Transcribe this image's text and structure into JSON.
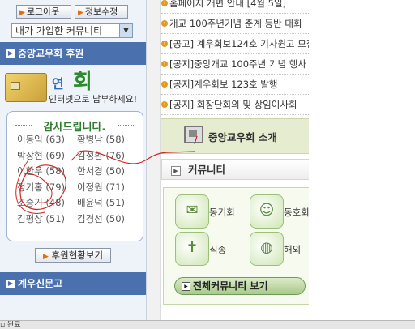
{
  "left": {
    "logout_label": "로그아웃",
    "edit_info_label": "정보수정",
    "community_select": "내가 가입한 커뮤니티",
    "support_heading": "중앙교우회 후원",
    "banner": {
      "big1": "연",
      "big2": "회",
      "sub": "인터넷으로 납부하세요!"
    },
    "thanks_title": "감사드립니다.",
    "donors": [
      [
        "이동익 (63)",
        "황병남 (58)"
      ],
      [
        "박상현 (69)",
        "김성환 (76)"
      ],
      [
        "이한우 (58)",
        "한서경 (50)"
      ],
      [
        "정기홍 (79)",
        "이정원 (71)"
      ],
      [
        "조승기 (48)",
        "배윤덕 (51)"
      ],
      [
        "김평상 (51)",
        "김경선 (50)"
      ]
    ],
    "view_status_label": "후원현황보기",
    "news_heading": "계우신문고"
  },
  "right": {
    "notices": [
      "홈페이지 개편 안내 [4월 5일]",
      "개교 100주년기념 춘계 등반 대회",
      "[공고] 계우회보124호 기사원고 모집",
      "[공지]중앙개교 100주년 기념 행사",
      "[공지]계우회보 123호 발행",
      "[공지] 회장단회의 및 상임이사회"
    ],
    "intro_label": "중앙교우회 소개",
    "community_heading": "커뮤니티",
    "community_items": [
      {
        "label": "동기회",
        "icon": "dongihoe-icon"
      },
      {
        "label": "동호회",
        "icon": "club-icon"
      },
      {
        "label": "직종",
        "icon": "job-icon"
      },
      {
        "label": "해외",
        "icon": "globe-icon"
      }
    ],
    "all_community_label": "전체커뮤니티 보기"
  },
  "status_bar": {
    "text": "완료"
  }
}
